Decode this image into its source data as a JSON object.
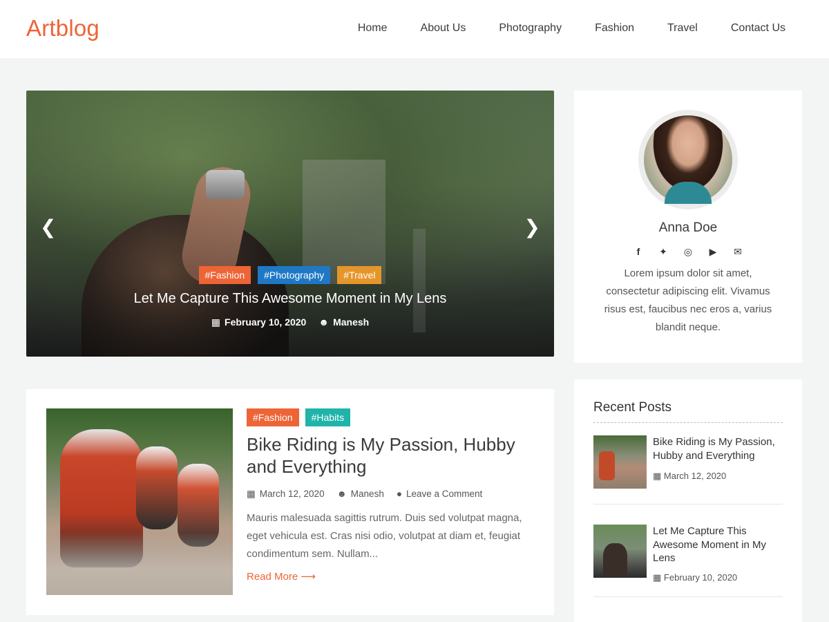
{
  "header": {
    "logo": "Artblog",
    "nav": [
      "Home",
      "About Us",
      "Photography",
      "Fashion",
      "Travel",
      "Contact Us"
    ]
  },
  "hero": {
    "tags": [
      "#Fashion",
      "#Photography",
      "#Travel"
    ],
    "title": "Let Me Capture This Awesome Moment in My Lens",
    "date": "February 10, 2020",
    "author": "Manesh",
    "prev_icon": "chevron-left-icon",
    "next_icon": "chevron-right-icon"
  },
  "profile": {
    "name": "Anna Doe",
    "socials": [
      "facebook-icon",
      "twitter-icon",
      "instagram-icon",
      "youtube-icon",
      "envelope-icon"
    ],
    "bio": "Lorem ipsum dolor sit amet, consectetur adipiscing elit. Vivamus risus est, faucibus nec eros a, varius blandit neque."
  },
  "post": {
    "tags": [
      "#Fashion",
      "#Habits"
    ],
    "title": "Bike Riding is My Passion, Hubby and Everything",
    "date": "March 12, 2020",
    "author": "Manesh",
    "comments": "Leave a Comment",
    "excerpt": "Mauris malesuada sagittis rutrum. Duis sed volutpat magna, eget vehicula est. Cras nisi odio, volutpat at diam et, feugiat condimentum sem. Nullam...",
    "read_more": "Read More"
  },
  "recent": {
    "heading": "Recent Posts",
    "items": [
      {
        "title": "Bike Riding is My Passion, Hubby and Everything",
        "date": "March 12, 2020"
      },
      {
        "title": "Let Me Capture This Awesome Moment in My Lens",
        "date": "February 10, 2020"
      }
    ]
  },
  "colors": {
    "accent": "#ed6436",
    "tag_blue": "#1f78c6",
    "tag_amber": "#e5962a",
    "tag_teal": "#1fb3a9"
  }
}
